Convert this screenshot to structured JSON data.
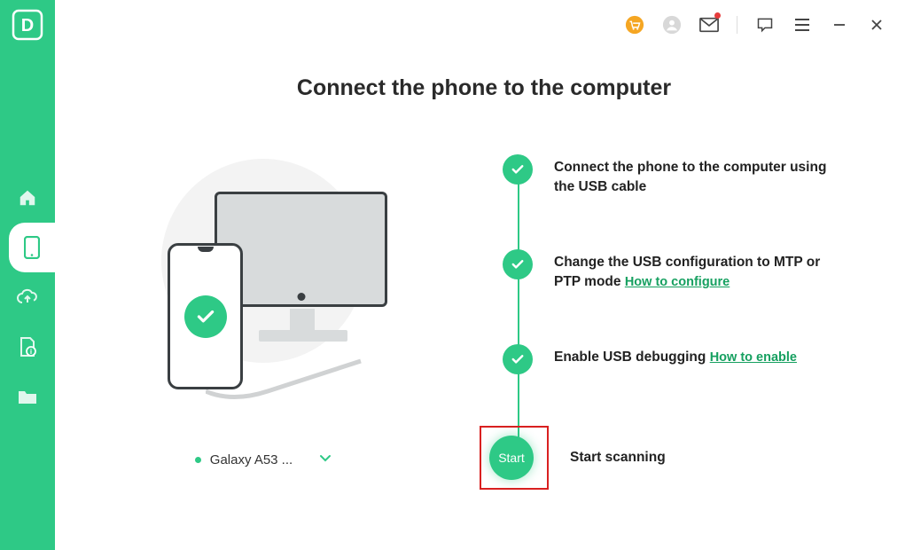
{
  "app": {
    "logo_letter": "D"
  },
  "titlebar": {
    "cart_icon": "cart",
    "user_icon": "user",
    "mail_icon": "mail",
    "feedback_icon": "feedback",
    "menu_icon": "menu",
    "minimize_icon": "minimize",
    "close_icon": "close"
  },
  "sidebar": {
    "items": [
      {
        "name": "home",
        "active": false
      },
      {
        "name": "phone",
        "active": true
      },
      {
        "name": "cloud",
        "active": false
      },
      {
        "name": "file-info",
        "active": false
      },
      {
        "name": "folder",
        "active": false
      }
    ]
  },
  "page": {
    "title": "Connect the phone to the computer"
  },
  "device": {
    "name": "Galaxy A53 ..."
  },
  "steps": [
    {
      "text": "Connect the phone to the computer using the USB cable",
      "link": ""
    },
    {
      "text": "Change the USB configuration to MTP or PTP mode",
      "link": "How to configure"
    },
    {
      "text": "Enable USB debugging",
      "link": "How to enable"
    }
  ],
  "start": {
    "button_label": "Start",
    "label": "Start scanning"
  },
  "colors": {
    "accent": "#2ec986",
    "highlight_box": "#d92020"
  }
}
